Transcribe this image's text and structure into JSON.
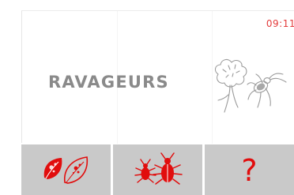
{
  "screen": {
    "clock": "09:11",
    "title": "RAVAGEURS",
    "hero_icon": "pest-on-plant-icon"
  },
  "toolbar": {
    "buttons": [
      {
        "icon": "diseased-leaves-icon"
      },
      {
        "icon": "insects-icon"
      },
      {
        "icon": "help-icon",
        "label": "?"
      }
    ]
  },
  "colors": {
    "accent": "#e10d0d",
    "title": "#8a8a8a",
    "toolbar_bg": "#c9c9c9"
  }
}
